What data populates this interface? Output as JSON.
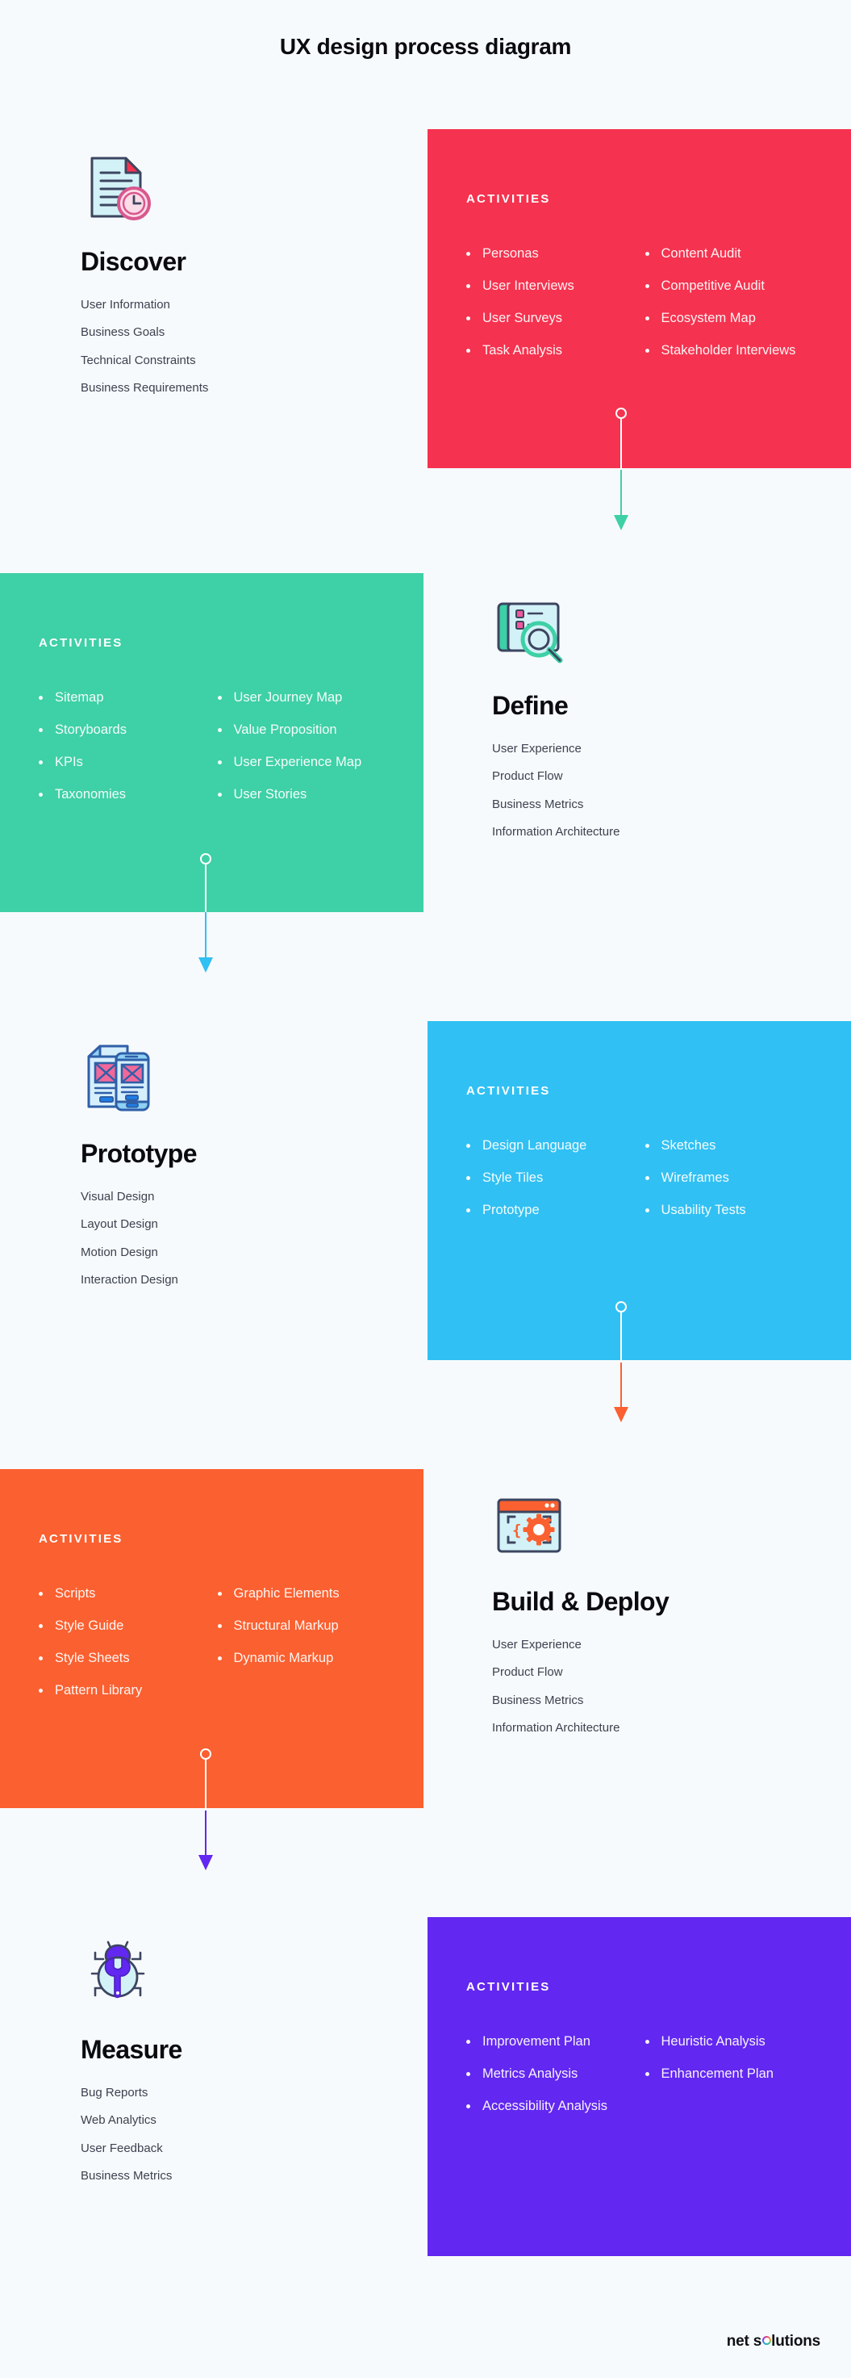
{
  "page": {
    "title": "UX design process diagram",
    "background_color": "#f7fafc",
    "footer_logo_pre": "net s",
    "footer_logo_post": "lutions"
  },
  "activities_heading": "ACTIVITIES",
  "stages": [
    {
      "name": "Discover",
      "icon": "document-clock-icon",
      "color": "#f5324f",
      "side": "left",
      "panel_side": "right",
      "points": [
        "User Information",
        "Business Goals",
        "Technical Constraints",
        "Business Requirements"
      ],
      "activities_col1": [
        "Personas",
        "User Interviews",
        "User Surveys",
        "Task Analysis"
      ],
      "activities_col2": [
        "Content Audit",
        "Competitive Audit",
        "Ecosystem Map",
        "Stakeholder Interviews"
      ]
    },
    {
      "name": "Define",
      "icon": "magnifier-board-icon",
      "color": "#3ed0a6",
      "side": "right",
      "panel_side": "left",
      "points": [
        "User Experience",
        "Product Flow",
        "Business Metrics",
        "Information Architecture"
      ],
      "activities_col1": [
        "Sitemap",
        "Storyboards",
        "KPIs",
        "Taxonomies"
      ],
      "activities_col2": [
        "User Journey Map",
        "Value Proposition",
        "User Experience Map",
        "User Stories"
      ]
    },
    {
      "name": "Prototype",
      "icon": "wireframe-mobile-icon",
      "color": "#31c0f3",
      "side": "left",
      "panel_side": "right",
      "points": [
        "Visual Design",
        "Layout Design",
        "Motion Design",
        "Interaction Design"
      ],
      "activities_col1": [
        "Design Language",
        "Style Tiles",
        "Prototype"
      ],
      "activities_col2": [
        "Sketches",
        "Wireframes",
        "Usability Tests"
      ]
    },
    {
      "name": "Build & Deploy",
      "icon": "browser-code-gear-icon",
      "color": "#fb6030",
      "side": "right",
      "panel_side": "left",
      "points": [
        "User Experience",
        "Product Flow",
        "Business Metrics",
        "Information Architecture"
      ],
      "activities_col1": [
        "Scripts",
        "Style Guide",
        "Style Sheets",
        "Pattern Library"
      ],
      "activities_col2": [
        "Graphic Elements",
        "Structural Markup",
        "Dynamic Markup"
      ]
    },
    {
      "name": "Measure",
      "icon": "bug-wrench-icon",
      "color": "#6227f0",
      "side": "left",
      "panel_side": "right",
      "points": [
        "Bug Reports",
        "Web Analytics",
        "User Feedback",
        "Business Metrics"
      ],
      "activities_col1": [
        "Improvement Plan",
        "Metrics Analysis",
        "Accessibility Analysis"
      ],
      "activities_col2": [
        "Heuristic Analysis",
        "Enhancement Plan"
      ]
    }
  ],
  "connectors": [
    {
      "from": "Discover",
      "to": "Define",
      "from_color": "#f5324f",
      "to_color": "#3ed0a6"
    },
    {
      "from": "Define",
      "to": "Prototype",
      "from_color": "#3ed0a6",
      "to_color": "#31c0f3"
    },
    {
      "from": "Prototype",
      "to": "Build & Deploy",
      "from_color": "#31c0f3",
      "to_color": "#fb6030"
    },
    {
      "from": "Build & Deploy",
      "to": "Measure",
      "from_color": "#fb6030",
      "to_color": "#6227f0"
    }
  ]
}
